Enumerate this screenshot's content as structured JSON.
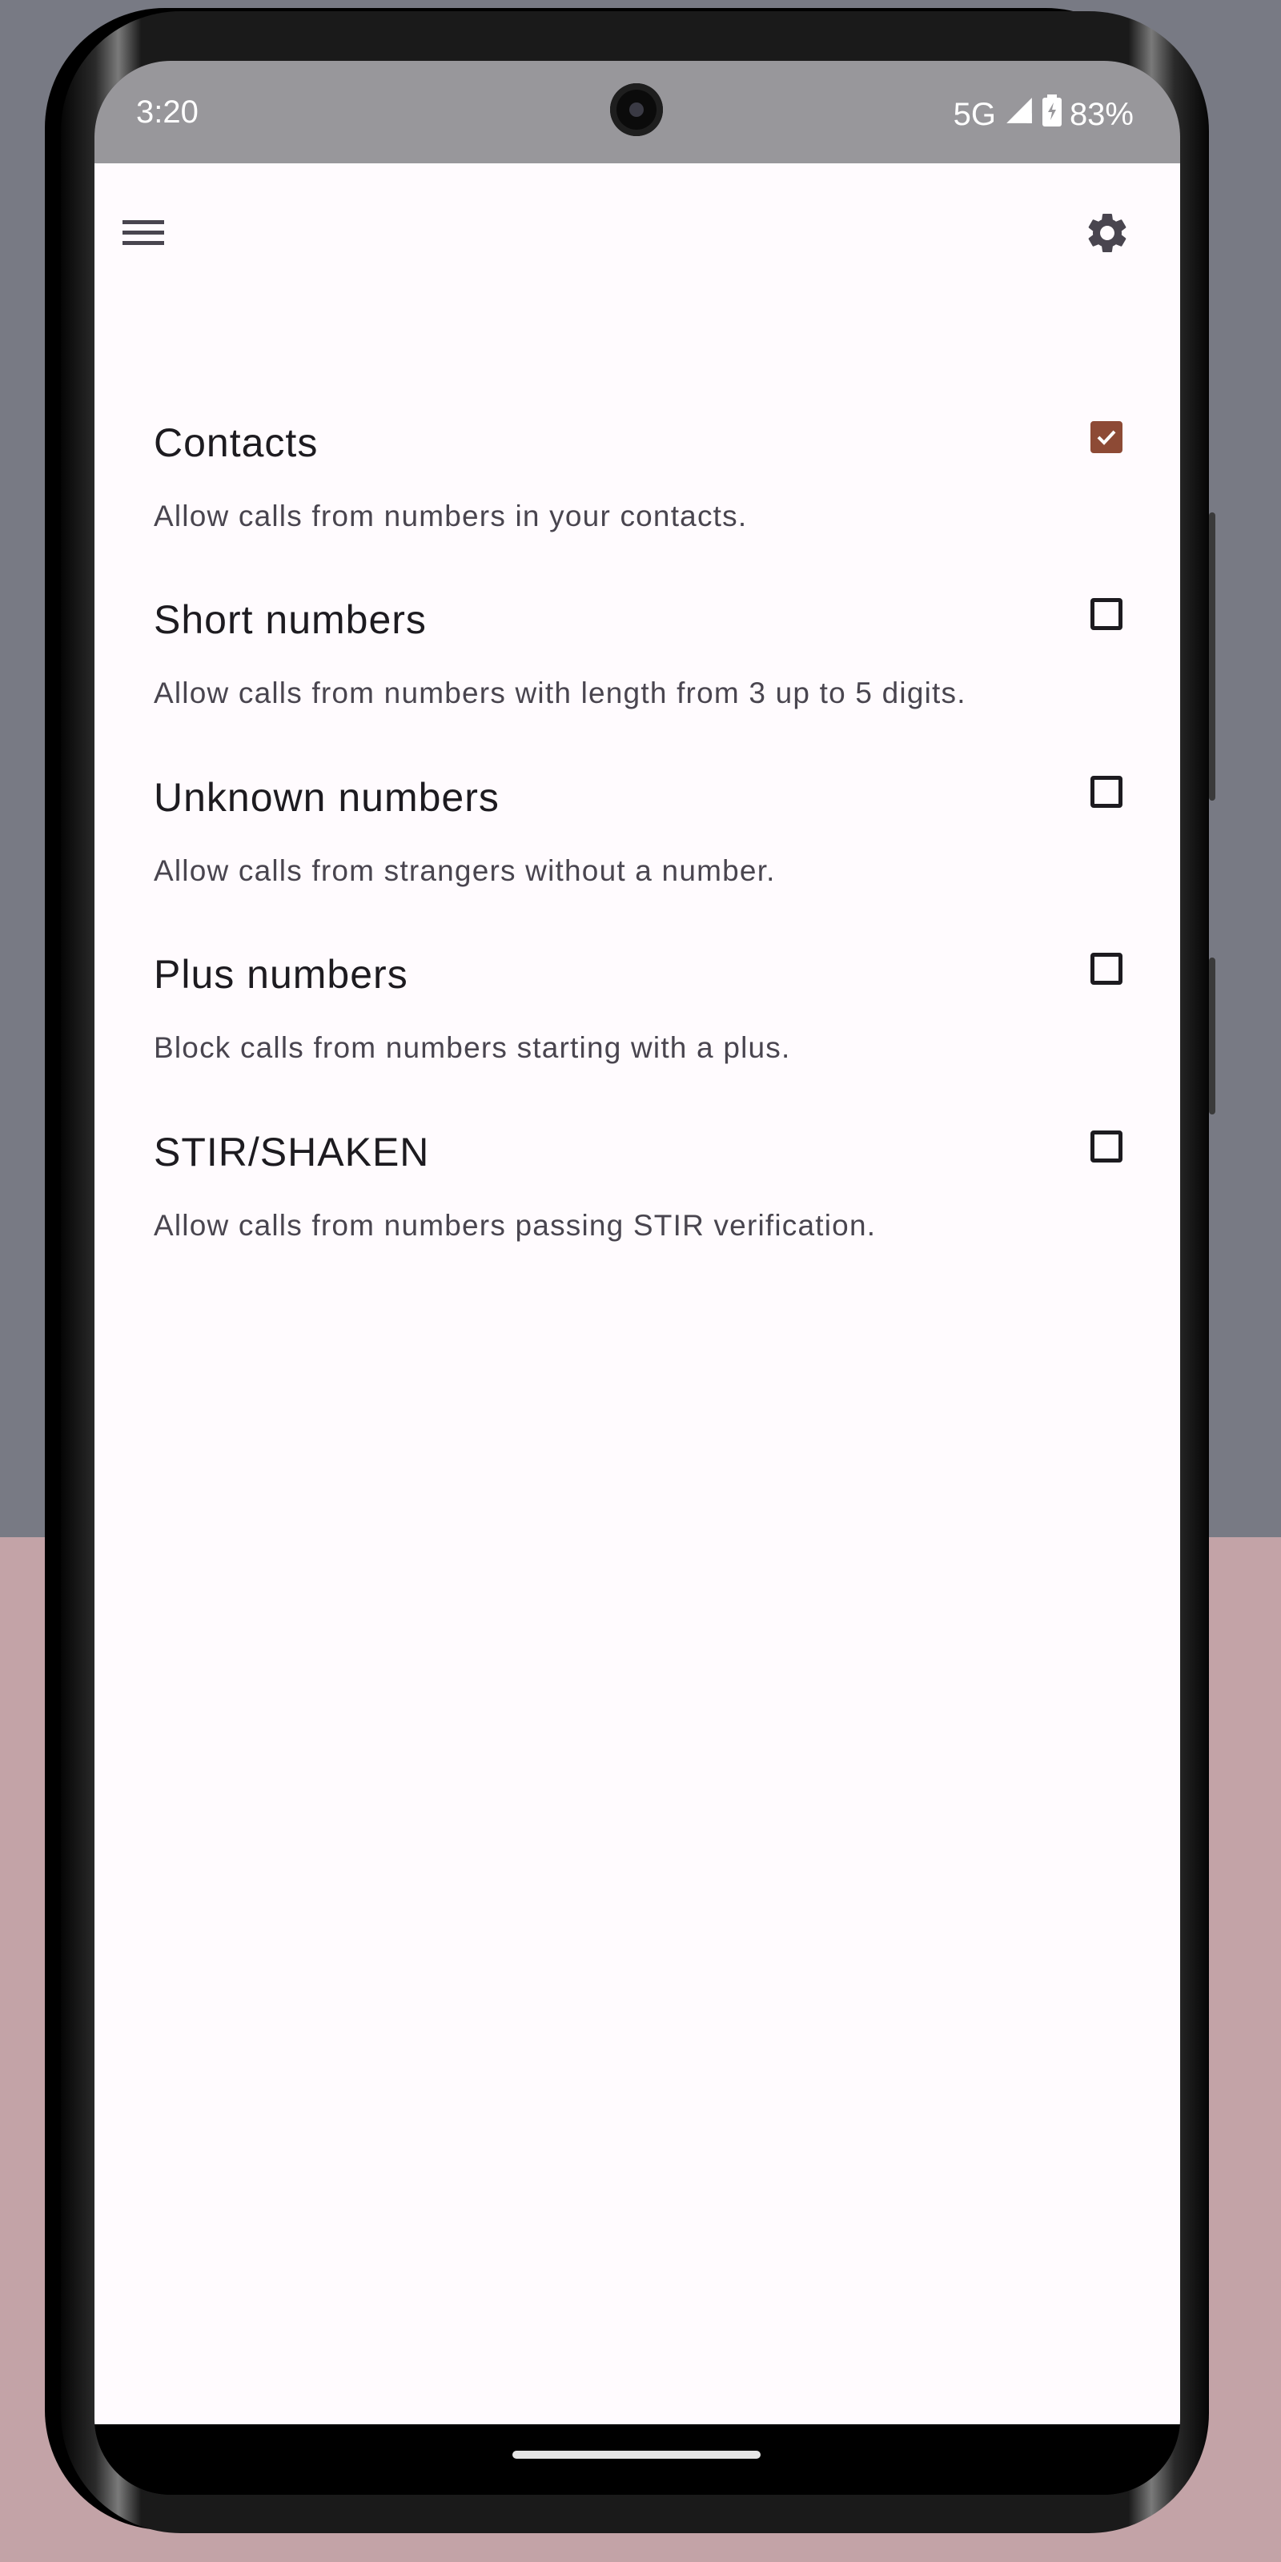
{
  "status_bar": {
    "time": "3:20",
    "network": "5G",
    "battery": "83%",
    "icons": [
      "signal-icon",
      "battery-charging-icon"
    ]
  },
  "toolbar": {
    "menu_icon": "hamburger-menu-icon",
    "settings_icon": "gear-icon"
  },
  "settings": {
    "items": [
      {
        "title": "Contacts",
        "description": "Allow calls from numbers in your contacts.",
        "checked": true
      },
      {
        "title": "Short numbers",
        "description": "Allow calls from numbers with length from 3 up to 5 digits.",
        "checked": false
      },
      {
        "title": "Unknown numbers",
        "description": "Allow calls from strangers without a number.",
        "checked": false
      },
      {
        "title": "Plus numbers",
        "description": "Block calls from numbers starting with a plus.",
        "checked": false
      },
      {
        "title": "STIR/SHAKEN",
        "description": "Allow calls from numbers passing STIR verification.",
        "checked": false
      }
    ]
  },
  "colors": {
    "accent": "#8d4a35",
    "app_background": "#fffbfe",
    "status_bar": "#98979b"
  }
}
